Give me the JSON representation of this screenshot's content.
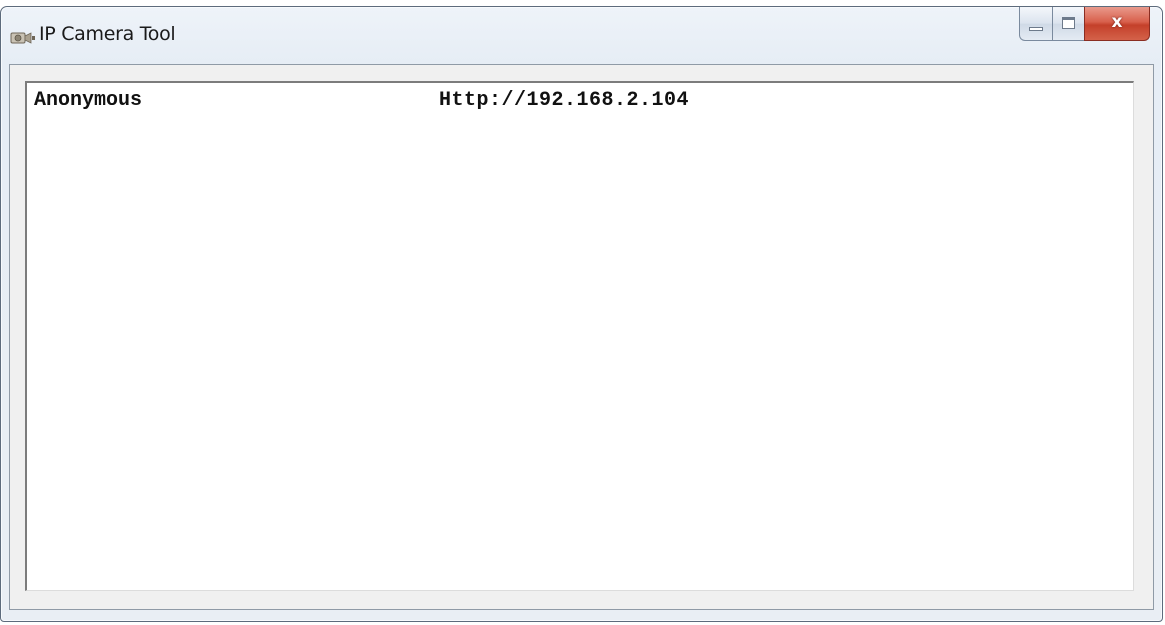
{
  "window": {
    "title": "IP Camera Tool",
    "icon": "camera-icon"
  },
  "caption_buttons": {
    "minimize_icon": "minimize-icon",
    "maximize_icon": "maximize-icon",
    "close_label": "x"
  },
  "device_list": {
    "rows": [
      {
        "name": "Anonymous",
        "url": "Http://192.168.2.104"
      }
    ]
  },
  "colors": {
    "close_button": "#c4402a",
    "window_frame": "#e6edf5"
  }
}
